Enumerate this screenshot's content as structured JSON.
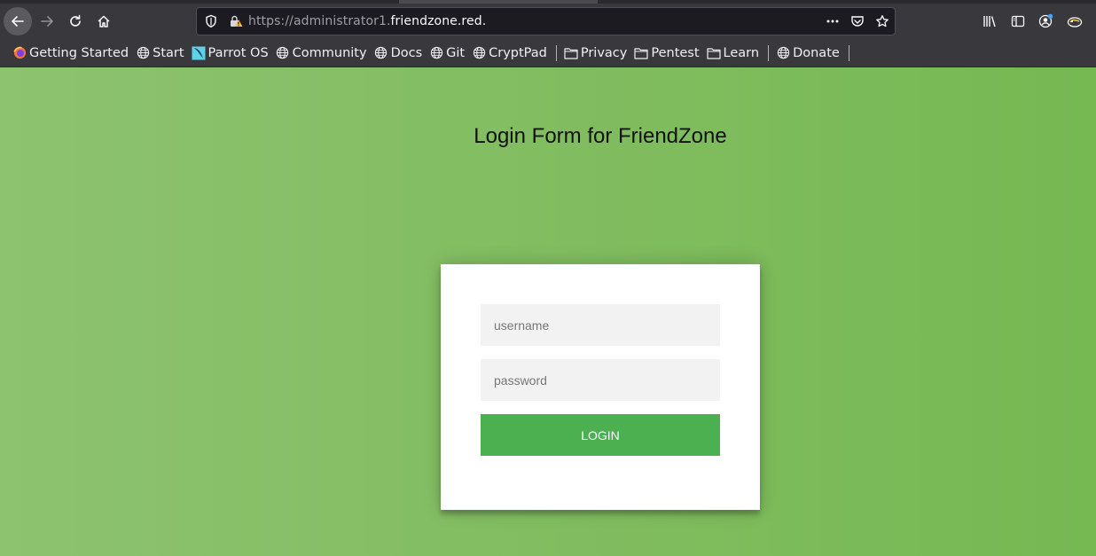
{
  "browser": {
    "url": {
      "prefix": "https://administrator1.",
      "domain": "friendzone.red",
      "suffix": "."
    },
    "icons": {
      "back": "arrow-left-icon",
      "forward": "arrow-right-icon",
      "reload": "reload-icon",
      "home": "home-icon",
      "tracking": "shield-icon",
      "insecure": "warning-lock-icon",
      "page_actions": "more-horizontal-icon",
      "pocket": "pocket-icon",
      "bookmark_star": "star-icon",
      "library": "library-icon",
      "sidebar": "sidebar-icon",
      "account": "account-icon",
      "extension": "parrot-icon"
    },
    "bookmarks": [
      {
        "label": "Getting Started",
        "icon": "firefox-icon"
      },
      {
        "label": "Start",
        "icon": "globe-icon"
      },
      {
        "label": "Parrot OS",
        "icon": "parrot-logo-icon"
      },
      {
        "label": "Community",
        "icon": "globe-icon"
      },
      {
        "label": "Docs",
        "icon": "globe-icon"
      },
      {
        "label": "Git",
        "icon": "globe-icon"
      },
      {
        "label": "CryptPad",
        "icon": "globe-icon"
      },
      {
        "label": "Privacy",
        "icon": "folder-icon"
      },
      {
        "label": "Pentest",
        "icon": "folder-icon"
      },
      {
        "label": "Learn",
        "icon": "folder-icon"
      },
      {
        "label": "Donate",
        "icon": "globe-icon"
      }
    ]
  },
  "page": {
    "title": "Login Form for FriendZone",
    "form": {
      "username_placeholder": "username",
      "username_value": "",
      "password_placeholder": "password",
      "password_value": "",
      "login_label": "LOGIN"
    }
  },
  "colors": {
    "bg_start": "#8dc26f",
    "bg_end": "#76b852",
    "button": "#4caf50",
    "chrome": "#38383d"
  }
}
